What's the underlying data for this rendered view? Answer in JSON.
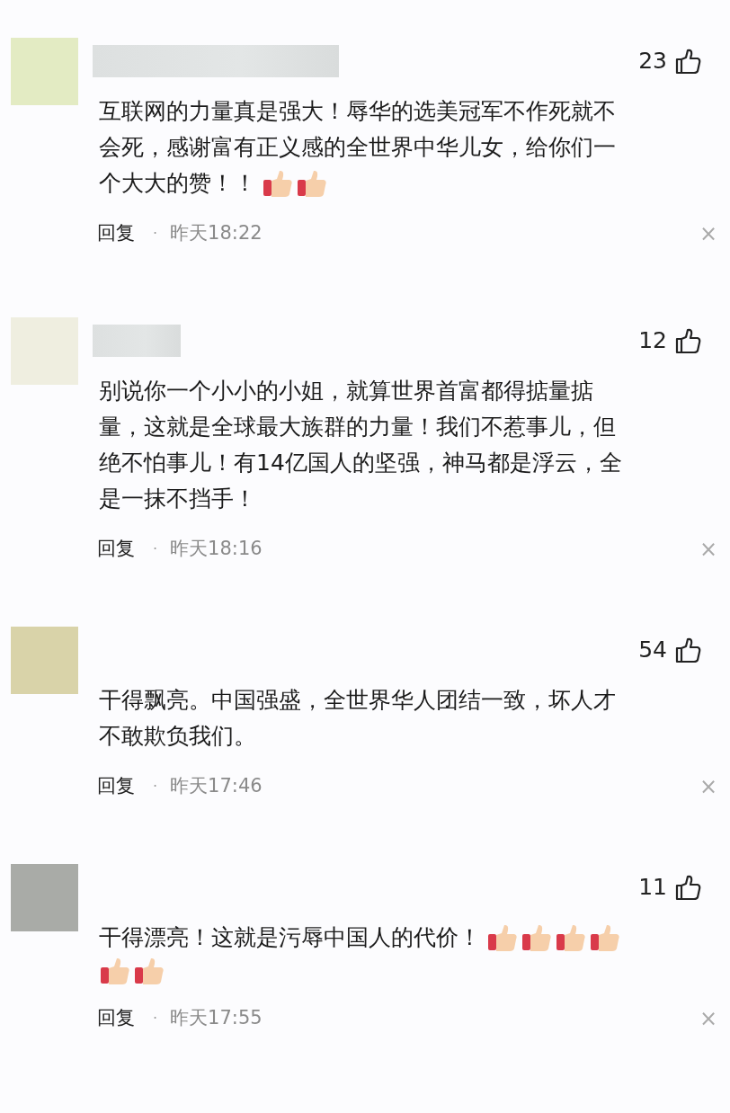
{
  "comments": [
    {
      "color": "#e3ebc3",
      "likes": "23",
      "lines": [
        "互联网的力量真是强大！辱华的选美冠军不作死就不",
        "会死，感谢富有正义感的全世界中华儿女，给你们一",
        "个大大的赞！！"
      ],
      "emoji": [
        {
          "kind": "thumbs-up"
        },
        {
          "kind": "thumbs-up"
        }
      ],
      "reply": "回复",
      "separator": "·",
      "time": "昨天18:22",
      "close": "×"
    },
    {
      "color": "#efeee0",
      "likes": "12",
      "lines": [
        "别说你一个小小的小姐，就算世界首富都得掂量掂",
        "量，这就是全球最大族群的力量！我们不惹事儿，但",
        "绝不怕事儿！有14亿国人的坚强，神马都是浮云，全",
        "是一抹不挡手！"
      ],
      "reply": "回复",
      "separator": "·",
      "time": "昨天18:16",
      "close": "×"
    },
    {
      "color": "#d9d3a9",
      "likes": "54",
      "lines": [
        "干得飘亮。中国强盛，全世界华人团结一致，坏人才",
        "不敢欺负我们。"
      ],
      "reply": "回复",
      "separator": "·",
      "time": "昨天17:46",
      "close": "×"
    },
    {
      "color": "#a9aba7",
      "likes": "11",
      "lines": [
        "干得漂亮！这就是污辱中国人的代价！"
      ],
      "emoji": [
        {
          "kind": "thumbs-up"
        },
        {
          "kind": "thumbs-up"
        },
        {
          "kind": "thumbs-up"
        },
        {
          "kind": "thumbs-up"
        },
        {
          "kind": "thumbs-up"
        },
        {
          "kind": "thumbs-up"
        }
      ],
      "reply": "回复",
      "separator": "·",
      "time": "昨天17:55",
      "close": "×"
    }
  ]
}
